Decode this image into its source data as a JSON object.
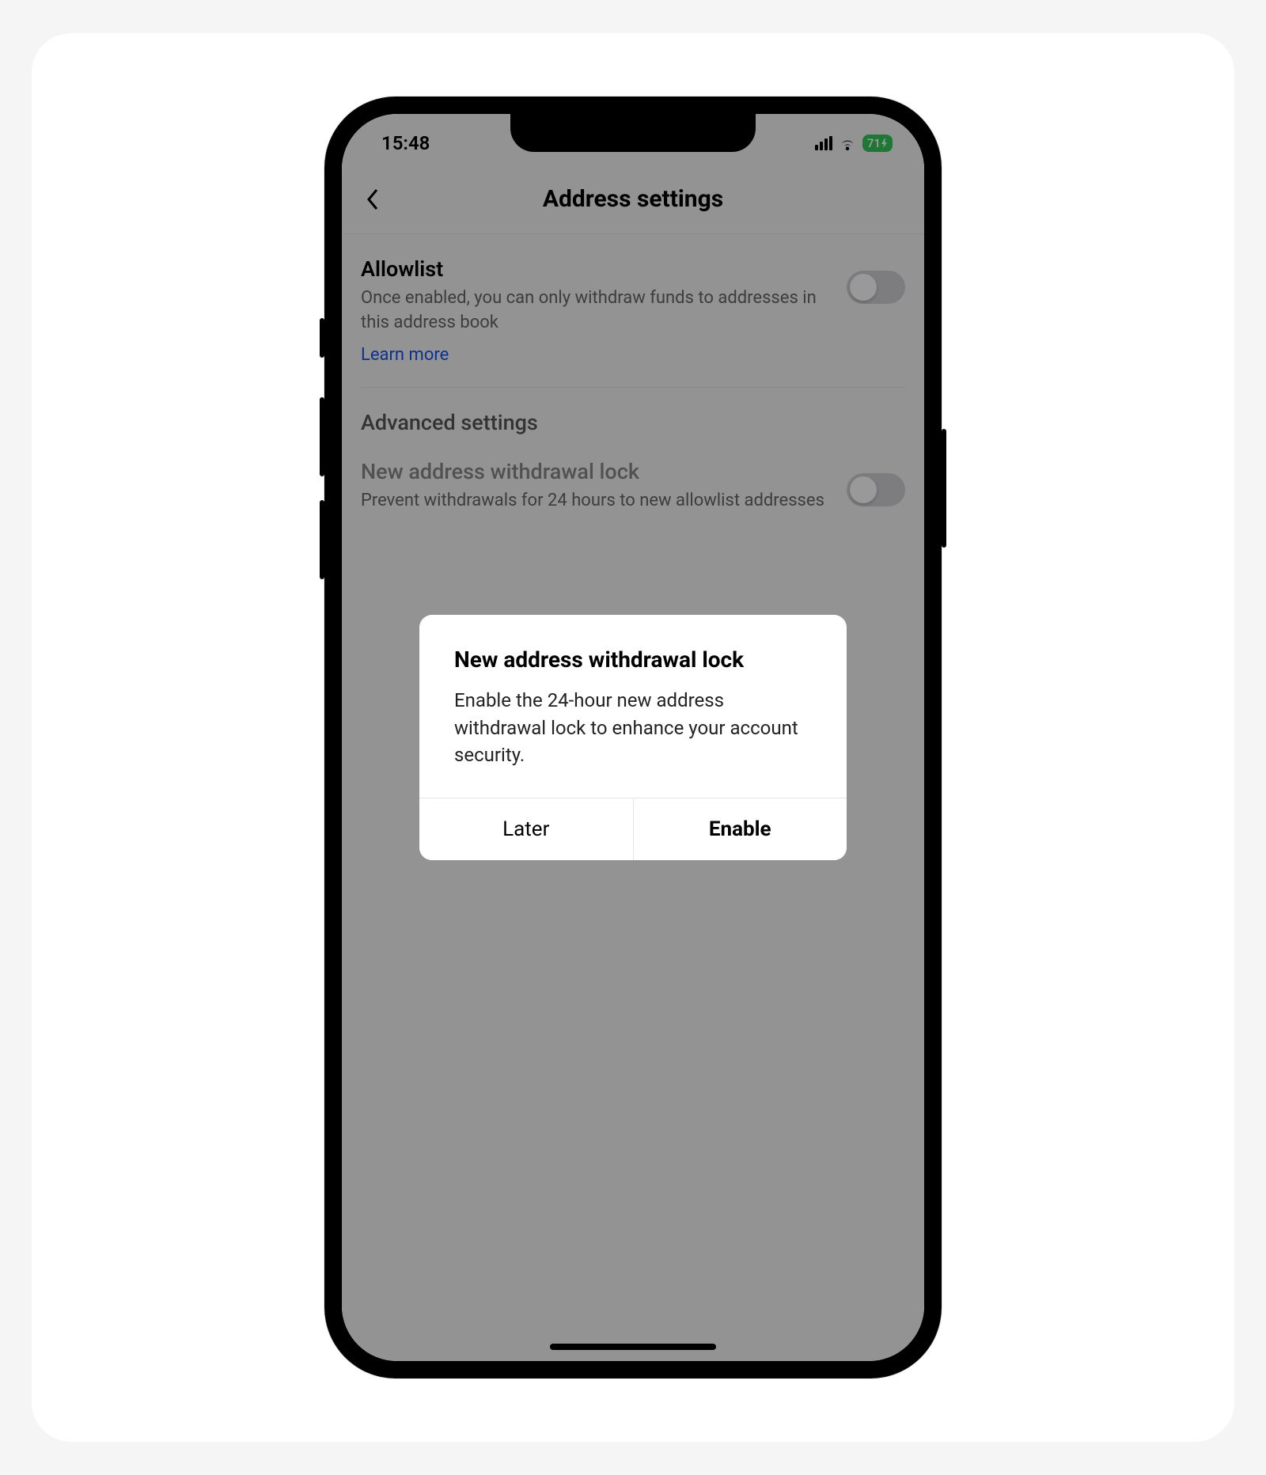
{
  "status_bar": {
    "time": "15:48",
    "battery": "71"
  },
  "header": {
    "title": "Address settings"
  },
  "allowlist": {
    "title": "Allowlist",
    "description": "Once enabled, you can only withdraw funds to addresses in this address book",
    "learn_more": "Learn more"
  },
  "advanced": {
    "section_header": "Advanced settings",
    "withdrawal_lock": {
      "title": "New address withdrawal lock",
      "description": "Prevent withdrawals for 24 hours to new allowlist addresses"
    }
  },
  "modal": {
    "title": "New address withdrawal lock",
    "body": "Enable the 24-hour new address withdrawal lock to enhance your account security.",
    "later": "Later",
    "enable": "Enable"
  }
}
